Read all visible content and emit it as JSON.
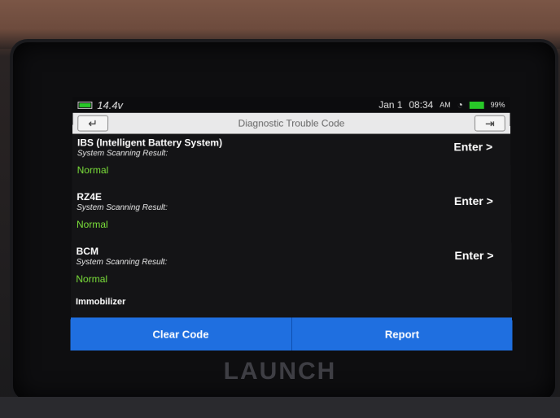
{
  "status": {
    "voltage": "14.4v",
    "date": "Jan 1",
    "time": "08:34",
    "ampm": "AM",
    "battery": "99%"
  },
  "nav": {
    "back_icon": "back-arrow-icon",
    "title": "Diagnostic Trouble Code",
    "exit_icon": "exit-icon"
  },
  "systems": [
    {
      "name": "IBS (Intelligent Battery System)",
      "subtitle": "System Scanning Result:",
      "status": "Normal",
      "action": "Enter >"
    },
    {
      "name": "RZ4E",
      "subtitle": "System Scanning Result:",
      "status": "Normal",
      "action": "Enter >"
    },
    {
      "name": "BCM",
      "subtitle": "System Scanning Result:",
      "status": "Normal",
      "action": "Enter >"
    }
  ],
  "partial_item": "Immobilizer",
  "actions": {
    "clear_code": "Clear Code",
    "report": "Report"
  },
  "brand": "LAUNCH",
  "colors": {
    "status_normal": "#7be03a",
    "button_blue": "#1f6fe0"
  }
}
